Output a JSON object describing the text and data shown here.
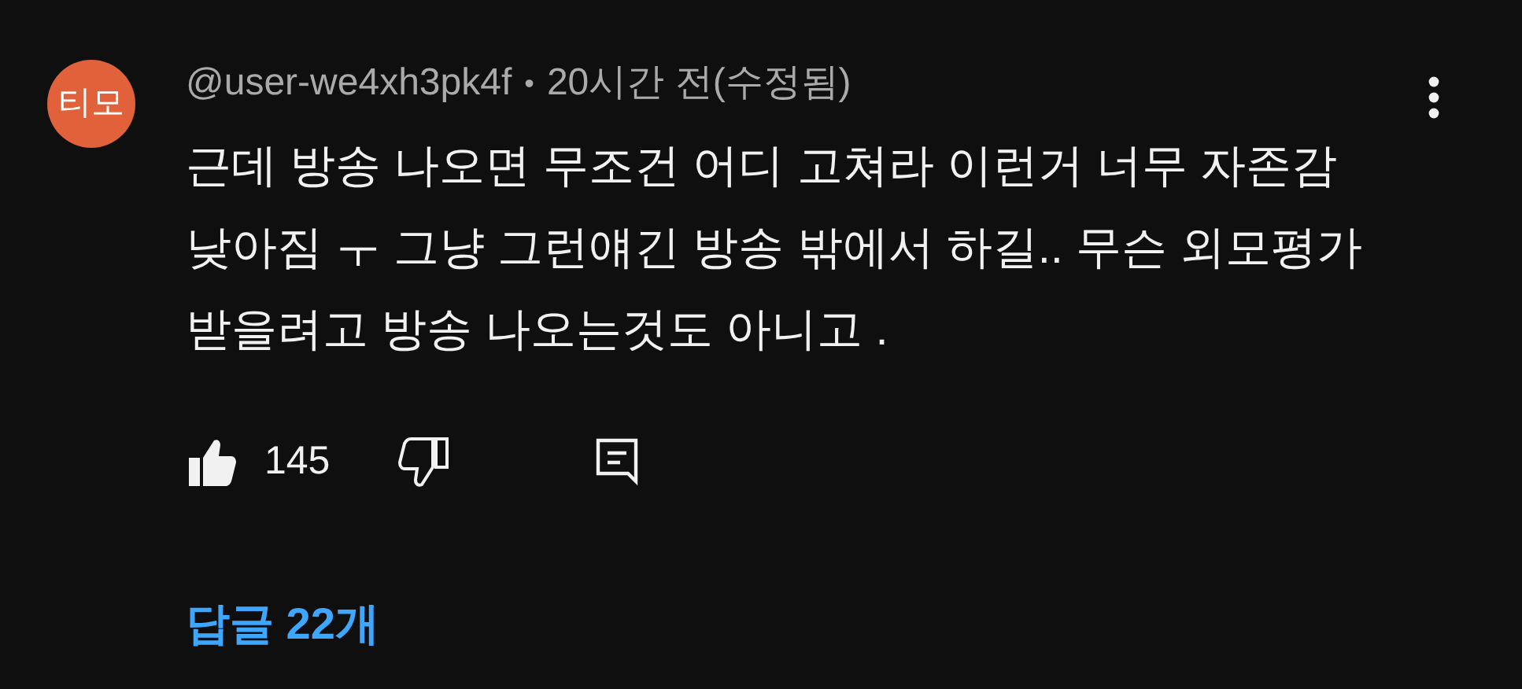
{
  "comment": {
    "avatar_text": "티모",
    "author": "@user-we4xh3pk4f",
    "separator": "•",
    "time": "20시간 전(수정됨)",
    "text_lines": [
      "근데 방송 나오면 무조건 어디 고쳐라 이런거 너무 자존감",
      "낮아짐 ㅜ 그냥 그런얘긴 방송 밖에서 하길.. 무슨 외모평가",
      "받을려고 방송 나오는것도 아니고 ."
    ],
    "liked": true,
    "disliked": false,
    "like_count": "145",
    "replies": "답글 22개"
  }
}
